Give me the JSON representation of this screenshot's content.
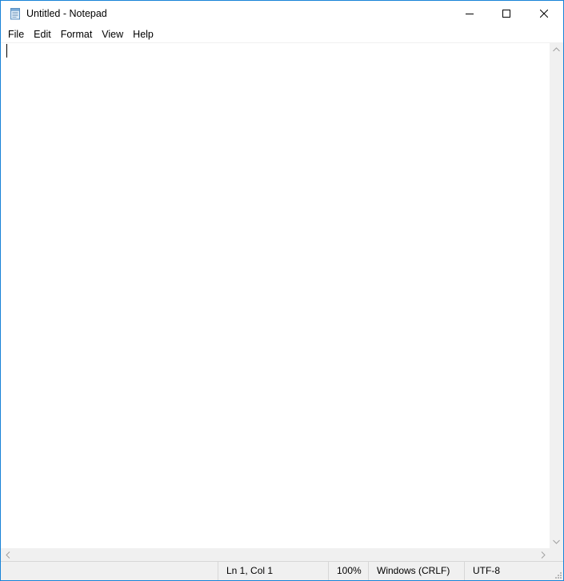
{
  "window": {
    "title": "Untitled - Notepad",
    "icon": "notepad-icon",
    "accent_color": "#1883d7"
  },
  "caption_buttons": {
    "minimize": "minimize-icon",
    "maximize": "maximize-icon",
    "close": "close-icon"
  },
  "menu": {
    "items": [
      {
        "label": "File"
      },
      {
        "label": "Edit"
      },
      {
        "label": "Format"
      },
      {
        "label": "View"
      },
      {
        "label": "Help"
      }
    ]
  },
  "editor": {
    "content": ""
  },
  "statusbar": {
    "position": "Ln 1, Col 1",
    "zoom": "100%",
    "line_ending": "Windows (CRLF)",
    "encoding": "UTF-8"
  }
}
